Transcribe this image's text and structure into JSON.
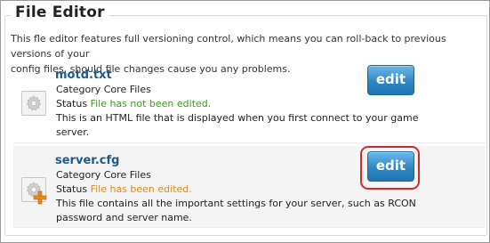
{
  "panel": {
    "title": "File Editor",
    "intro_line1": "This fle editor features full versioning control, which means you can roll-back to previous versions of your",
    "intro_line2": "config files, should file changes cause you any problems."
  },
  "labels": {
    "category": "Category",
    "status": "Status"
  },
  "files": [
    {
      "name": "motd.txt",
      "category": "Core Files",
      "status": "File has not been edited.",
      "desc_line1": "This is an HTML file that is displayed when you first connect to your game",
      "desc_line2": "server.",
      "edit_label": "edit",
      "icon": "gear-icon"
    },
    {
      "name": "server.cfg",
      "category": "Core Files",
      "status": "File has been edited.",
      "desc_line1": "This file contains all the important settings for your server, such as RCON",
      "desc_line2": "password and server name.",
      "edit_label": "edit",
      "icon": "gear-icon",
      "overlay_icon": "plus-icon"
    }
  ],
  "colors": {
    "status_not_edited": "#3a9a1f",
    "status_edited": "#e08a13",
    "button_blue": "#2f87c6",
    "highlight": "#d12a2a"
  }
}
